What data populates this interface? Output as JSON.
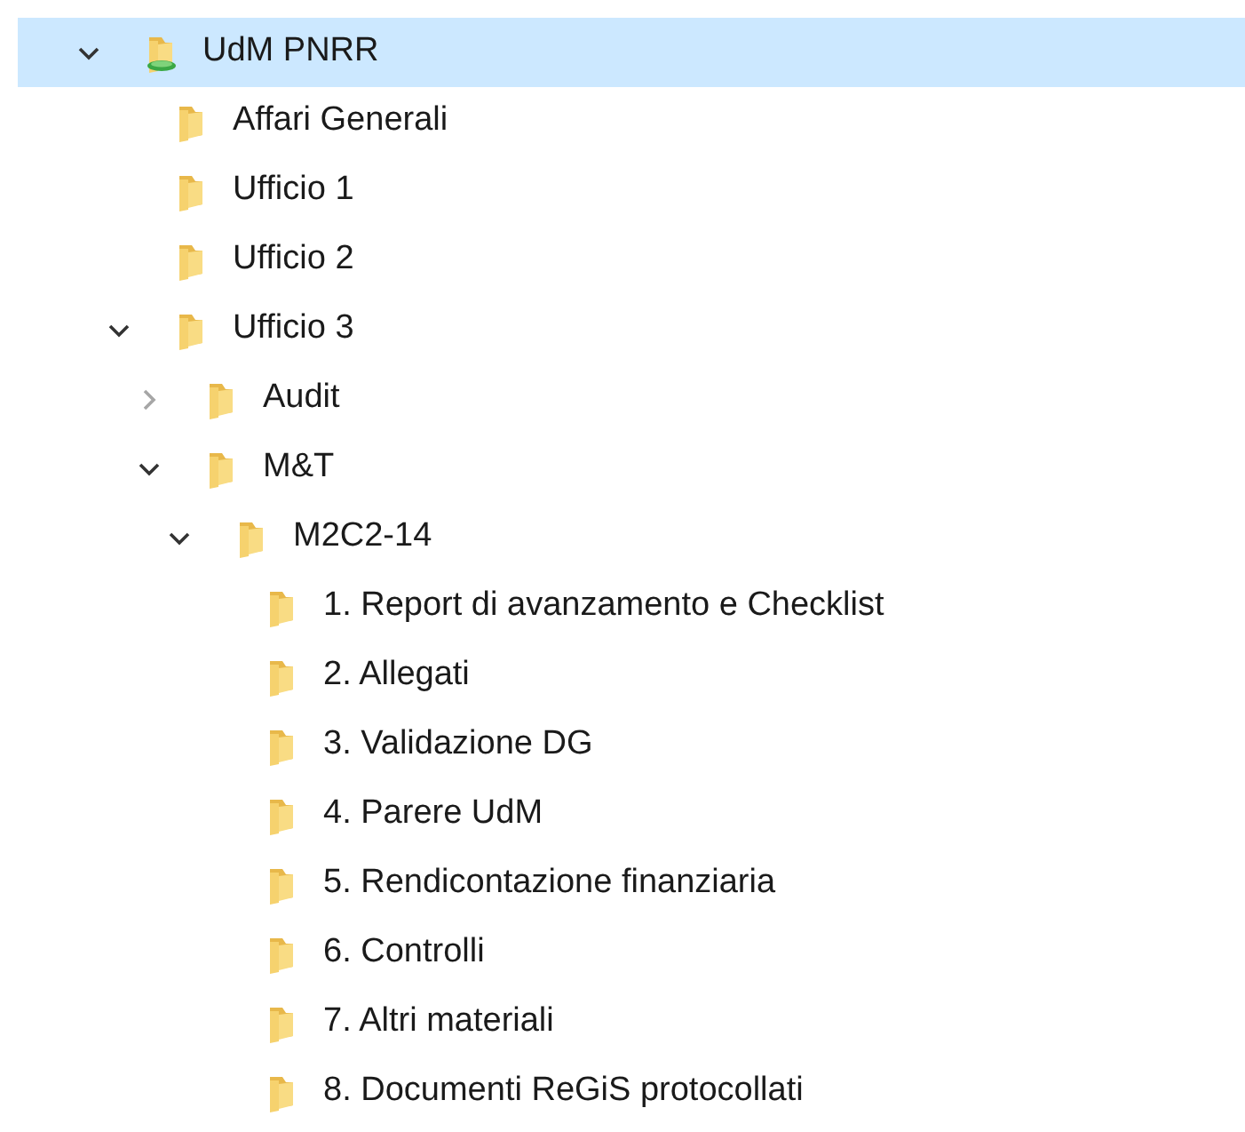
{
  "tree": [
    {
      "label": "UdM PNRR",
      "kind": "shared",
      "selected": true,
      "expanded": true,
      "children": [
        {
          "label": "Affari Generali",
          "kind": "folder",
          "selected": false
        },
        {
          "label": "Ufficio 1",
          "kind": "folder",
          "selected": false
        },
        {
          "label": "Ufficio 2",
          "kind": "folder",
          "selected": false
        },
        {
          "label": "Ufficio 3",
          "kind": "folder",
          "selected": false,
          "expanded": true,
          "children": [
            {
              "label": "Audit",
              "kind": "folder",
              "selected": false,
              "expanded": false
            },
            {
              "label": "M&T",
              "kind": "folder",
              "selected": false,
              "expanded": true,
              "children": [
                {
                  "label": "M2C2-14",
                  "kind": "folder",
                  "selected": false,
                  "expanded": true,
                  "children": [
                    {
                      "label": "1. Report di avanzamento e Checklist",
                      "kind": "folder",
                      "selected": false
                    },
                    {
                      "label": "2. Allegati",
                      "kind": "folder",
                      "selected": false
                    },
                    {
                      "label": "3. Validazione DG",
                      "kind": "folder",
                      "selected": false
                    },
                    {
                      "label": "4. Parere UdM",
                      "kind": "folder",
                      "selected": false
                    },
                    {
                      "label": "5. Rendicontazione finanziaria",
                      "kind": "folder",
                      "selected": false
                    },
                    {
                      "label": "6. Controlli",
                      "kind": "folder",
                      "selected": false
                    },
                    {
                      "label": "7. Altri materiali",
                      "kind": "folder",
                      "selected": false
                    },
                    {
                      "label": "8. Documenti ReGiS protocollati",
                      "kind": "folder",
                      "selected": false
                    }
                  ]
                }
              ]
            }
          ]
        }
      ]
    }
  ]
}
